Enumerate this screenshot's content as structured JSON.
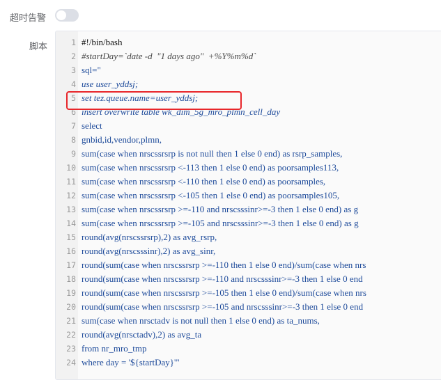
{
  "form": {
    "alarm_label": "超时告警",
    "alarm_enabled": false,
    "script_label": "脚本"
  },
  "colors": {
    "highlight": "#e8262a",
    "code_blue": "#1d4a9a"
  },
  "script_lines": [
    {
      "n": "1",
      "text": "#!/bin/bash",
      "style": "normal"
    },
    {
      "n": "2",
      "text": "#startDay=`date -d  \"1 days ago\"  +%Y%m%d`",
      "style": "str"
    },
    {
      "n": "3",
      "text": "sql=\"",
      "style": "blue"
    },
    {
      "n": "4",
      "text": "use user_yddsj;",
      "style": "italic"
    },
    {
      "n": "5",
      "text": "set tez.queue.name=user_yddsj;",
      "style": "italic"
    },
    {
      "n": "6",
      "text": "insert overwrite table wk_dim_5g_mro_plmn_cell_day",
      "style": "italic"
    },
    {
      "n": "7",
      "text": "select",
      "style": "blue"
    },
    {
      "n": "8",
      "text": "gnbid,id,vendor,plmn,",
      "style": "blue"
    },
    {
      "n": "9",
      "text": "sum(case when nrscssrsrp is not null then 1 else 0 end) as rsrp_samples,",
      "style": "blue"
    },
    {
      "n": "10",
      "text": "sum(case when nrscssrsrp <-113 then 1 else 0 end) as poorsamples113,",
      "style": "blue"
    },
    {
      "n": "11",
      "text": "sum(case when nrscssrsrp <-110 then 1 else 0 end) as poorsamples,",
      "style": "blue"
    },
    {
      "n": "12",
      "text": "sum(case when nrscssrsrp <-105 then 1 else 0 end) as poorsamples105,",
      "style": "blue"
    },
    {
      "n": "13",
      "text": "sum(case when nrscssrsrp >=-110 and nrscsssinr>=-3 then 1 else 0 end) as g",
      "style": "blue"
    },
    {
      "n": "14",
      "text": "sum(case when nrscssrsrp >=-105 and nrscsssinr>=-3 then 1 else 0 end) as g",
      "style": "blue"
    },
    {
      "n": "15",
      "text": "round(avg(nrscssrsrp),2) as avg_rsrp,",
      "style": "blue"
    },
    {
      "n": "16",
      "text": "round(avg(nrscsssinr),2) as avg_sinr,",
      "style": "blue"
    },
    {
      "n": "17",
      "text": "round(sum(case when nrscssrsrp >=-110 then 1 else 0 end)/sum(case when nrs",
      "style": "blue"
    },
    {
      "n": "18",
      "text": "round(sum(case when nrscssrsrp >=-110 and nrscsssinr>=-3 then 1 else 0 end",
      "style": "blue"
    },
    {
      "n": "19",
      "text": "round(sum(case when nrscssrsrp >=-105 then 1 else 0 end)/sum(case when nrs",
      "style": "blue"
    },
    {
      "n": "20",
      "text": "round(sum(case when nrscssrsrp >=-105 and nrscsssinr>=-3 then 1 else 0 end",
      "style": "blue"
    },
    {
      "n": "21",
      "text": "sum(case when nrsctadv is not null then 1 else 0 end) as ta_nums,",
      "style": "blue"
    },
    {
      "n": "22",
      "text": "round(avg(nrsctadv),2) as avg_ta",
      "style": "blue"
    },
    {
      "n": "23",
      "text": "from nr_mro_tmp",
      "style": "blue"
    },
    {
      "n": "24",
      "text": "where day = '${startDay}'\"",
      "style": "blue"
    }
  ]
}
